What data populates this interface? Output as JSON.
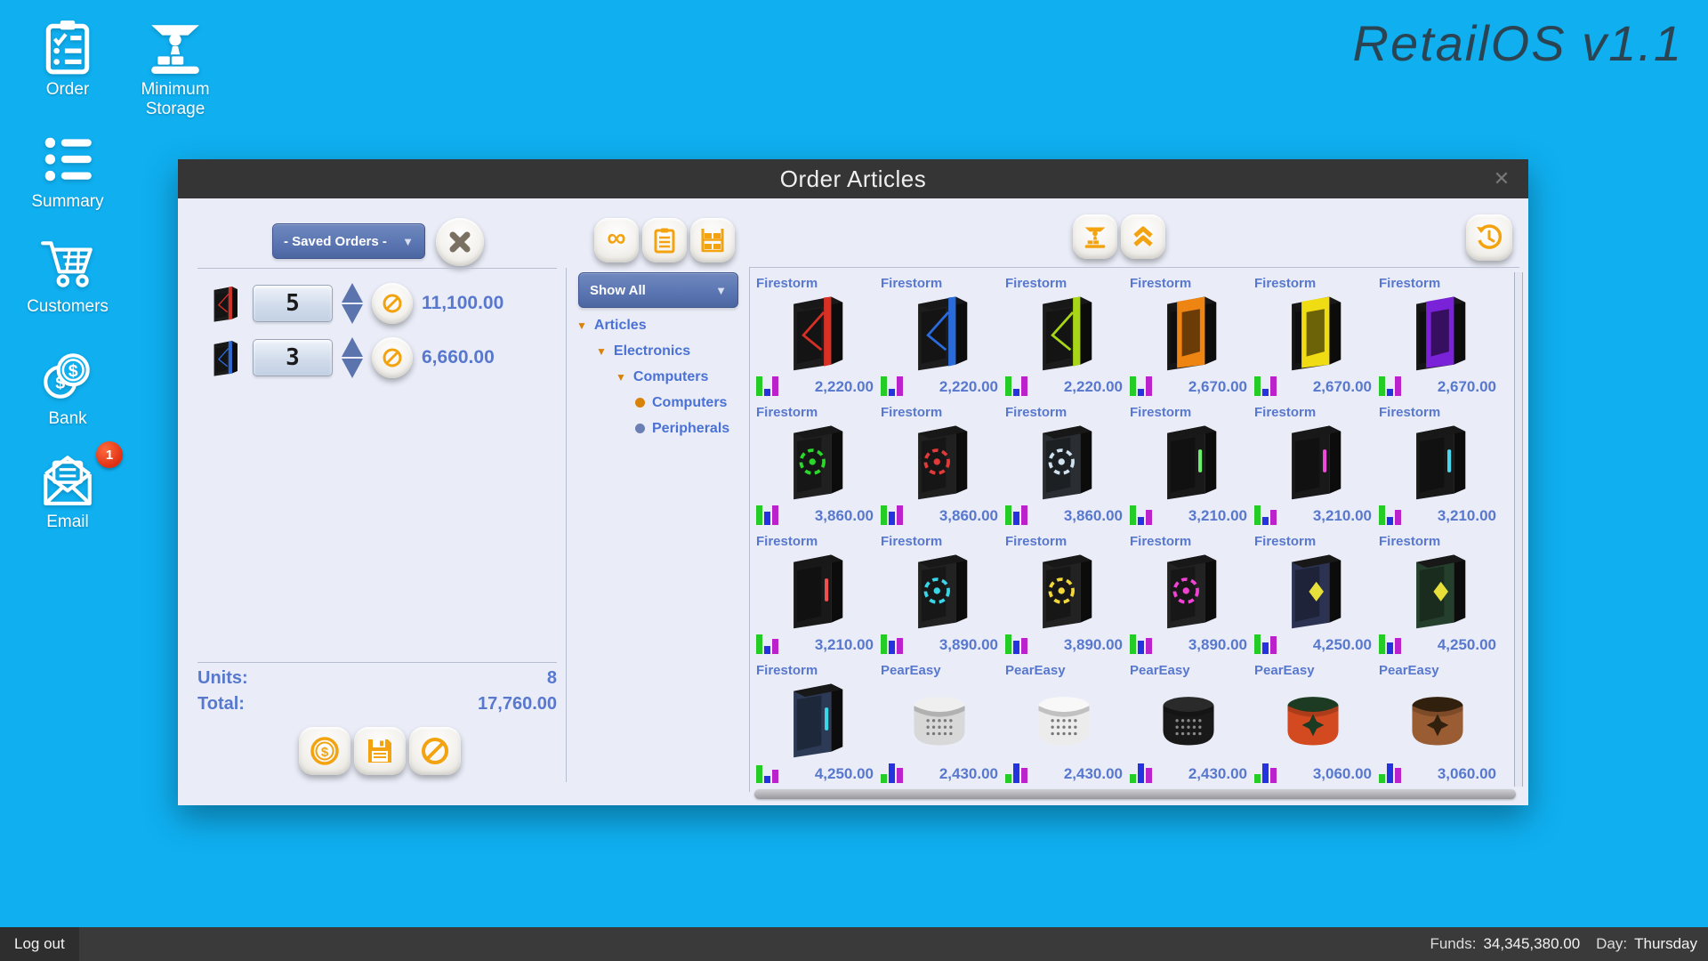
{
  "app": {
    "logo_text": "RetailOS v1.1"
  },
  "sidebar": {
    "items": [
      {
        "label": "Order"
      },
      {
        "label": "Minimum Storage"
      },
      {
        "label": "Summary"
      },
      {
        "label": "Customers"
      },
      {
        "label": "Bank"
      },
      {
        "label": "Email",
        "badge": "1"
      }
    ]
  },
  "statusbar": {
    "logout_label": "Log out",
    "funds_label": "Funds:",
    "funds_value": "34,345,380.00",
    "day_label": "Day:",
    "day_value": "Thursday"
  },
  "order_window": {
    "title": "Order Articles",
    "close_glyph": "✕",
    "saved_orders": {
      "value": "- Saved Orders -"
    },
    "order_rows": [
      {
        "qty": "5",
        "price": "11,100.00",
        "kind": "tower",
        "body": "#1d1d1d",
        "accent": "#d93025",
        "style": "edge"
      },
      {
        "qty": "3",
        "price": "6,660.00",
        "kind": "tower",
        "body": "#1d1d1d",
        "accent": "#2a6bdb",
        "style": "edge"
      }
    ],
    "units_label": "Units:",
    "units_value": "8",
    "total_label": "Total:",
    "total_value": "17,760.00",
    "filter": {
      "value": "Show All"
    },
    "tree": [
      {
        "label": "Articles",
        "depth": 0,
        "marker": "tri"
      },
      {
        "label": "Electronics",
        "depth": 1,
        "marker": "tri"
      },
      {
        "label": "Computers",
        "depth": 2,
        "marker": "tri"
      },
      {
        "label": "Computers",
        "depth": 3,
        "marker": "dot-orange"
      },
      {
        "label": "Peripherals",
        "depth": 3,
        "marker": "dot-blue"
      }
    ],
    "products": [
      {
        "name": "Firestorm",
        "price": "2,220.00",
        "kind": "tower",
        "body": "#1d1d1d",
        "accent": "#d93025",
        "style": "edge",
        "bars": [
          1,
          0.35,
          1
        ]
      },
      {
        "name": "Firestorm",
        "price": "2,220.00",
        "kind": "tower",
        "body": "#1d1d1d",
        "accent": "#2a6bdb",
        "style": "edge",
        "bars": [
          1,
          0.35,
          1
        ]
      },
      {
        "name": "Firestorm",
        "price": "2,220.00",
        "kind": "tower",
        "body": "#1d1d1d",
        "accent": "#a8d616",
        "style": "edge",
        "bars": [
          1,
          0.35,
          1
        ]
      },
      {
        "name": "Firestorm",
        "price": "2,670.00",
        "kind": "tower",
        "body": "#151515",
        "accent": "#ee8412",
        "style": "panel",
        "bars": [
          1,
          0.35,
          1
        ]
      },
      {
        "name": "Firestorm",
        "price": "2,670.00",
        "kind": "tower",
        "body": "#151515",
        "accent": "#f0dc12",
        "style": "panel",
        "bars": [
          1,
          0.35,
          1
        ]
      },
      {
        "name": "Firestorm",
        "price": "2,670.00",
        "kind": "tower",
        "body": "#151515",
        "accent": "#7a22d8",
        "style": "panel",
        "bars": [
          1,
          0.35,
          1
        ]
      },
      {
        "name": "Firestorm",
        "price": "3,860.00",
        "kind": "tower",
        "body": "#202020",
        "accent": "#2ad82a",
        "style": "fan",
        "bars": [
          1,
          0.7,
          1
        ]
      },
      {
        "name": "Firestorm",
        "price": "3,860.00",
        "kind": "tower",
        "body": "#202020",
        "accent": "#e23a3a",
        "style": "fan",
        "bars": [
          1,
          0.7,
          1
        ]
      },
      {
        "name": "Firestorm",
        "price": "3,860.00",
        "kind": "tower",
        "body": "#2a2e33",
        "accent": "#cfe2ee",
        "style": "fan",
        "bars": [
          1,
          0.7,
          1
        ]
      },
      {
        "name": "Firestorm",
        "price": "3,210.00",
        "kind": "tower",
        "body": "#191919",
        "accent": "#6cf06c",
        "style": "light",
        "bars": [
          1,
          0.4,
          0.75
        ]
      },
      {
        "name": "Firestorm",
        "price": "3,210.00",
        "kind": "tower",
        "body": "#191919",
        "accent": "#f04ad8",
        "style": "light",
        "bars": [
          1,
          0.4,
          0.75
        ]
      },
      {
        "name": "Firestorm",
        "price": "3,210.00",
        "kind": "tower",
        "body": "#191919",
        "accent": "#4ad8f0",
        "style": "light",
        "bars": [
          1,
          0.4,
          0.75
        ]
      },
      {
        "name": "Firestorm",
        "price": "3,210.00",
        "kind": "tower",
        "body": "#191919",
        "accent": "#f05050",
        "style": "light",
        "bars": [
          1,
          0.4,
          0.75
        ]
      },
      {
        "name": "Firestorm",
        "price": "3,890.00",
        "kind": "tower",
        "body": "#222222",
        "accent": "#3ad6e8",
        "style": "fan",
        "bars": [
          1,
          0.7,
          0.8
        ]
      },
      {
        "name": "Firestorm",
        "price": "3,890.00",
        "kind": "tower",
        "body": "#222222",
        "accent": "#f2d83b",
        "style": "fan",
        "bars": [
          1,
          0.7,
          0.8
        ]
      },
      {
        "name": "Firestorm",
        "price": "3,890.00",
        "kind": "tower",
        "body": "#222222",
        "accent": "#f043d4",
        "style": "fan",
        "bars": [
          1,
          0.7,
          0.8
        ]
      },
      {
        "name": "Firestorm",
        "price": "4,250.00",
        "kind": "tower",
        "body": "#2c3352",
        "accent": "#e8e03a",
        "style": "diamond",
        "bars": [
          1,
          0.6,
          0.9
        ]
      },
      {
        "name": "Firestorm",
        "price": "4,250.00",
        "kind": "tower",
        "body": "#24402c",
        "accent": "#e8e03a",
        "style": "diamond",
        "bars": [
          1,
          0.6,
          0.8
        ]
      },
      {
        "name": "Firestorm",
        "price": "4,250.00",
        "kind": "tower",
        "body": "#2c3a55",
        "accent": "#3ad6e8",
        "style": "light",
        "bars": [
          0.9,
          0.35,
          0.7
        ]
      },
      {
        "name": "PearEasy",
        "price": "2,430.00",
        "kind": "box",
        "body": "#d8d8d8",
        "lid": "#efefef",
        "accent": "#777777",
        "style": "dots",
        "bars": [
          0.45,
          1,
          0.75
        ]
      },
      {
        "name": "PearEasy",
        "price": "2,430.00",
        "kind": "box",
        "body": "#ececec",
        "lid": "#f8f8f8",
        "accent": "#777777",
        "style": "dots",
        "bars": [
          0.45,
          1,
          0.75
        ]
      },
      {
        "name": "PearEasy",
        "price": "2,430.00",
        "kind": "box",
        "body": "#191919",
        "lid": "#2a2a2a",
        "accent": "#8a8a8a",
        "style": "dots",
        "bars": [
          0.45,
          1,
          0.75
        ]
      },
      {
        "name": "PearEasy",
        "price": "3,060.00",
        "kind": "box",
        "body": "#d44a20",
        "lid": "#1d3a22",
        "accent": "#1d3a22",
        "style": "star",
        "bars": [
          0.45,
          1,
          0.75
        ]
      },
      {
        "name": "PearEasy",
        "price": "3,060.00",
        "kind": "box",
        "body": "#9a5c32",
        "lid": "#32200f",
        "accent": "#32200f",
        "style": "star",
        "bars": [
          0.45,
          1,
          0.75
        ]
      }
    ]
  },
  "colors": {
    "accent_orange": "#F2A30F",
    "text_blue": "#5878CE",
    "bar_green": "#25CC25",
    "bar_blue": "#2333DD",
    "bar_magenta": "#BB22CC",
    "background_blue": "#0FAFF0"
  }
}
